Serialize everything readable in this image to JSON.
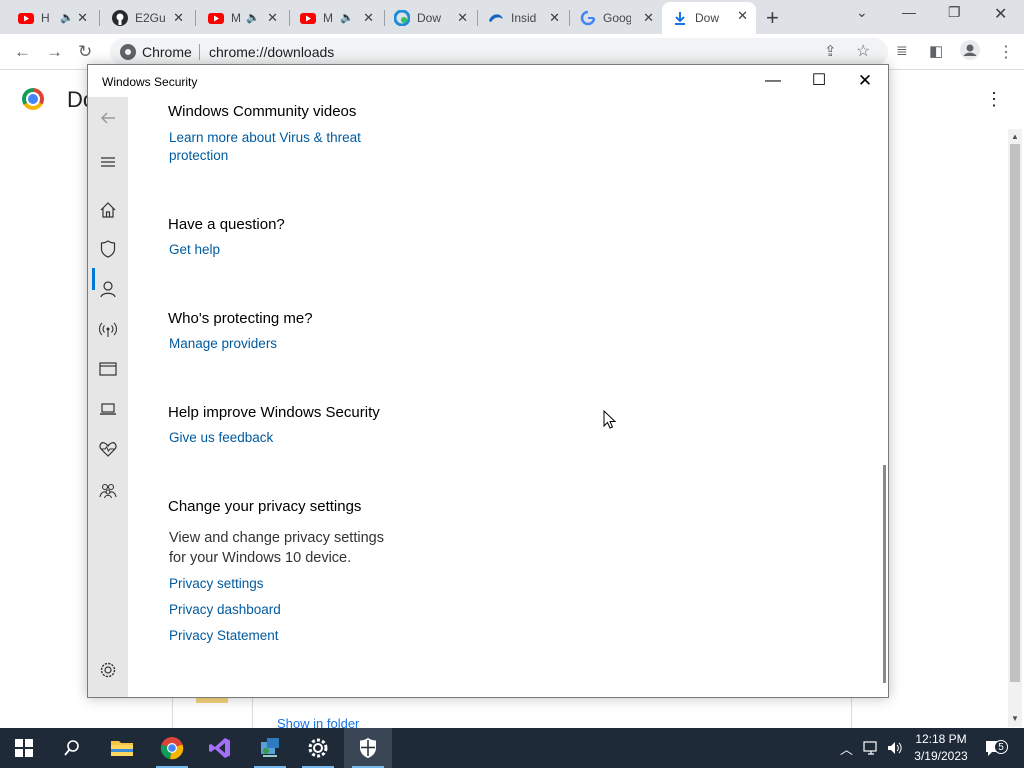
{
  "browser": {
    "tabs": [
      {
        "title": "H",
        "favicon": "youtube-icon",
        "muted": true
      },
      {
        "title": "E2Gu",
        "favicon": "github-icon",
        "muted": false
      },
      {
        "title": "M",
        "favicon": "youtube-icon",
        "muted": true
      },
      {
        "title": "M",
        "favicon": "youtube-icon",
        "muted": true
      },
      {
        "title": "Dow",
        "favicon": "edge-icon",
        "muted": false
      },
      {
        "title": "Insid",
        "favicon": "edge-beta-icon",
        "muted": false
      },
      {
        "title": "Goog",
        "favicon": "google-icon",
        "muted": false
      },
      {
        "title": "Dow",
        "favicon": "download-icon",
        "muted": false,
        "active": true
      }
    ],
    "omnibox": {
      "site_label": "Chrome",
      "url": "chrome://downloads"
    }
  },
  "downloads_page": {
    "title": "Do",
    "show_in_folder": "Show in folder"
  },
  "security_window": {
    "title": "Windows Security",
    "sections": {
      "community": {
        "heading": "Windows Community videos",
        "link_line1": "Learn more about Virus & threat",
        "link_line2": "protection"
      },
      "question": {
        "heading": "Have a question?",
        "link": "Get help"
      },
      "protecting": {
        "heading": "Who's protecting me?",
        "link": "Manage providers"
      },
      "improve": {
        "heading": "Help improve Windows Security",
        "link": "Give us feedback"
      },
      "privacy": {
        "heading": "Change your privacy settings",
        "body_line1": "View and change privacy settings",
        "body_line2": "for your Windows 10 device.",
        "links": [
          "Privacy settings",
          "Privacy dashboard",
          "Privacy Statement"
        ]
      }
    },
    "nav_icons": [
      "back-arrow-icon",
      "hamburger-menu-icon",
      "home-icon",
      "shield-icon",
      "person-icon",
      "wireless-icon",
      "app-browser-icon",
      "laptop-icon",
      "health-heart-icon",
      "family-icon",
      "settings-gear-icon"
    ]
  },
  "taskbar": {
    "clock_time": "12:18 PM",
    "clock_date": "3/19/2023",
    "notification_count": "5"
  },
  "colors": {
    "link": "#005a9e",
    "chrome_tabstrip": "#dee1e6",
    "taskbar": "#1f2a38",
    "accent": "#0078d4"
  }
}
